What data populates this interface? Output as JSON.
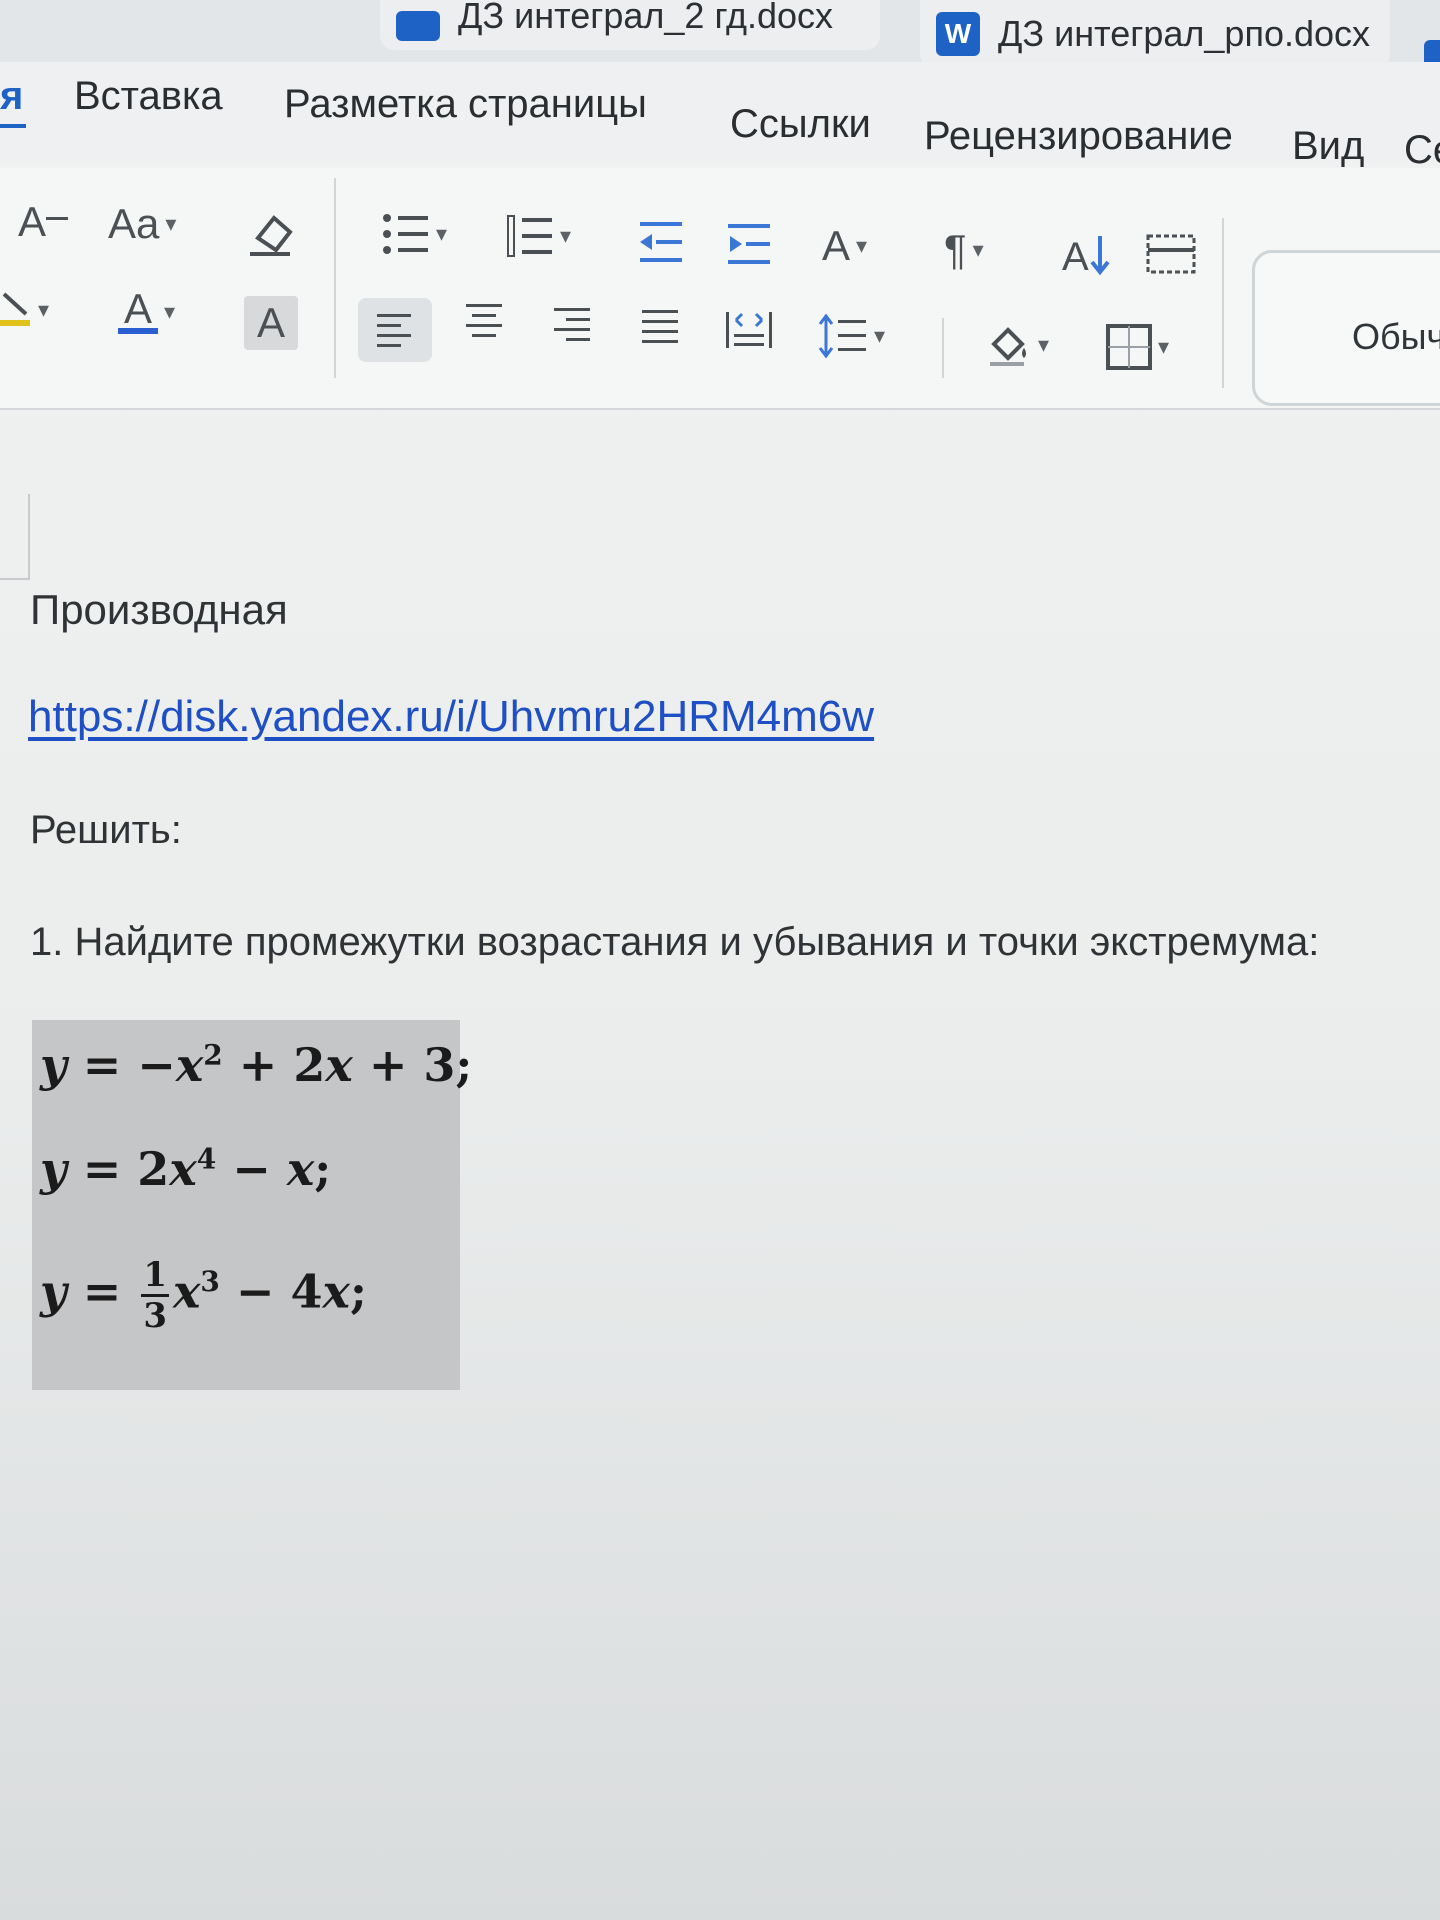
{
  "tabs": [
    {
      "label": "ДЗ интеграл_2 гд.docx"
    },
    {
      "label": "ДЗ интеграл_рпо.docx",
      "icon": "word-icon",
      "icon_letter": "W"
    }
  ],
  "menu": {
    "partial_left": "я",
    "items": [
      "Вставка",
      "Разметка страницы",
      "Ссылки",
      "Рецензирование",
      "Вид",
      "Се"
    ]
  },
  "toolbar": {
    "font_grow": "A",
    "change_case": "Aa",
    "font_color_letter": "A",
    "char_shading_letter": "A",
    "style_preview": "Обыч"
  },
  "document": {
    "heading": "Производная",
    "link": "https://disk.yandex.ru/i/Uhvmru2HRM4m6w",
    "solve": "Решить:",
    "task": "1. Найдите промежутки возрастания и убывания и точки экстремума:",
    "formulas": [
      "y = −x² + 2x + 3;",
      "y = 2x⁴ − x;",
      "y = 1/3 x³ − 4x;"
    ]
  },
  "colors": {
    "accent": "#1f62c6",
    "link": "#1f4fc4",
    "formula_bg": "#c4c6c7"
  }
}
